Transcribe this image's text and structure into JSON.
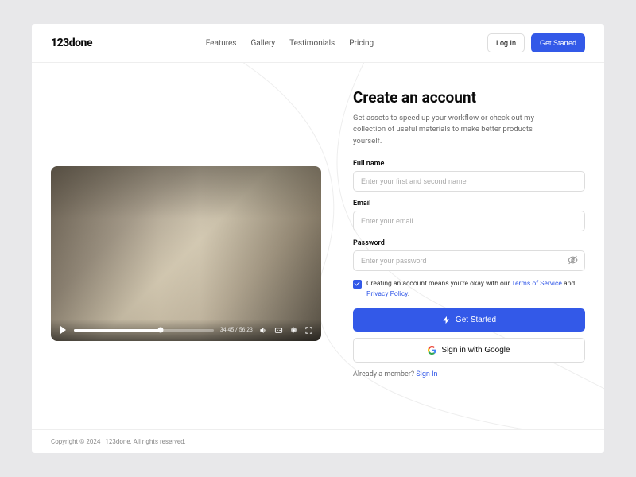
{
  "brand": "123done",
  "nav": {
    "features": "Features",
    "gallery": "Gallery",
    "testimonials": "Testimonials",
    "pricing": "Pricing"
  },
  "header_actions": {
    "login": "Log In",
    "get_started": "Get Started"
  },
  "video": {
    "current_time": "34:45",
    "duration": "56:23"
  },
  "signup": {
    "title": "Create an account",
    "subtitle": "Get assets to speed up your workflow or check out my collection of useful materials to make better products yourself.",
    "fields": {
      "fullname_label": "Full name",
      "fullname_placeholder": "Enter your first and second name",
      "email_label": "Email",
      "email_placeholder": "Enter your email",
      "password_label": "Password",
      "password_placeholder": "Enter your password"
    },
    "terms_prefix": "Creating an account means you're okay with our ",
    "terms_tos": "Terms of Service",
    "terms_and": " and ",
    "terms_privacy": "Privacy Policy",
    "terms_suffix": ".",
    "cta": "Get Started",
    "google": "Sign in with Google",
    "already_prefix": "Already a member? ",
    "already_link": "Sign In"
  },
  "footer": "Copyright © 2024 | 123done. All rights reserved."
}
